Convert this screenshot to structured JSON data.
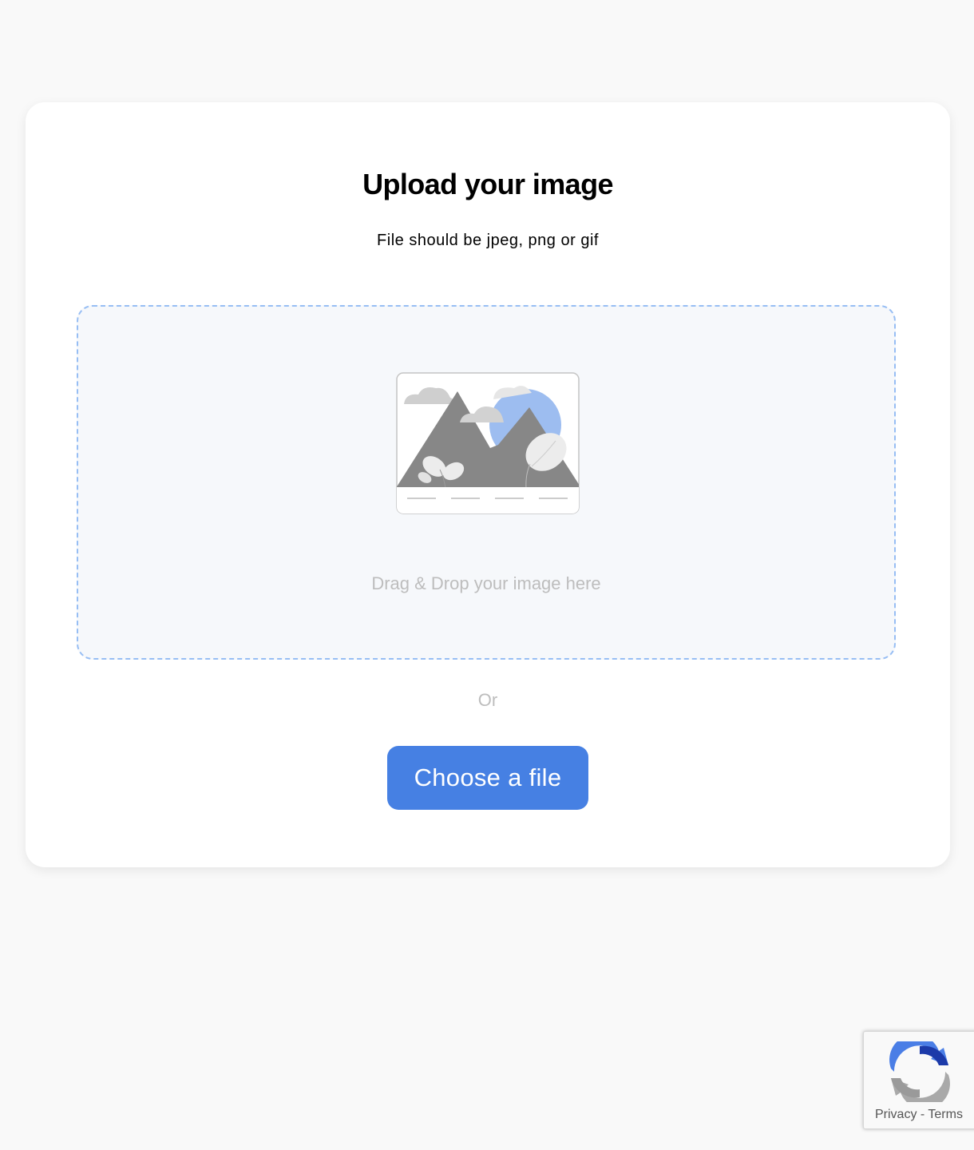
{
  "upload": {
    "title": "Upload your image",
    "subtitle": "File should be jpeg, png or gif",
    "dropzone_text": "Drag & Drop your image here",
    "or_text": "Or",
    "choose_button": "Choose a file",
    "illustration_icon": "image-placeholder-icon"
  },
  "recaptcha": {
    "logo_icon": "recaptcha-logo-icon",
    "privacy": "Privacy",
    "separator": " - ",
    "terms": "Terms"
  },
  "colors": {
    "page_background": "#f9f9f9",
    "card_background": "#ffffff",
    "accent": "#4680e3",
    "dropzone_border": "#97bef4",
    "dropzone_background": "#f6f8fb",
    "muted_text": "#bdbdbd"
  }
}
